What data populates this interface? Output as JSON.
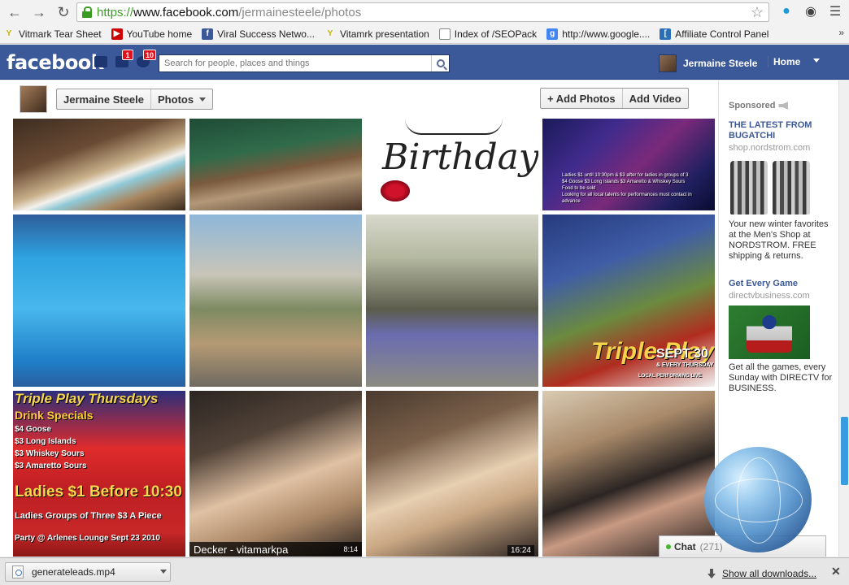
{
  "browser": {
    "url_scheme": "https://",
    "url_host": "www.facebook.com",
    "url_path": "/jermainesteele/photos",
    "bookmarks": [
      {
        "label": "Vitmark Tear Sheet",
        "icon": "vitmark-icon",
        "color": "#c8b400"
      },
      {
        "label": "YouTube home",
        "icon": "youtube-icon",
        "color": "#cc0000"
      },
      {
        "label": "Viral Success Netwo...",
        "icon": "facebook-icon",
        "color": "#3b5998"
      },
      {
        "label": "Vitamrk presentation",
        "icon": "vitmark-icon",
        "color": "#c8b400"
      },
      {
        "label": "Index of /SEOPack",
        "icon": "page-icon",
        "color": "#888888"
      },
      {
        "label": "http://www.google....",
        "icon": "google-icon",
        "color": "#4285f4"
      },
      {
        "label": "Affiliate Control Panel",
        "icon": "bracket-icon",
        "color": "#2d6fb7"
      }
    ],
    "bookmarks_more": "»"
  },
  "fb": {
    "logo": "facebook",
    "friend_requests_badge": "",
    "messages_badge": "1",
    "notifications_badge": "10",
    "search_placeholder": "Search for people, places and things",
    "user_name": "Jermaine Steele",
    "home_label": "Home"
  },
  "album": {
    "owner": "Jermaine Steele",
    "section": "Photos",
    "add_photos": "+ Add Photos",
    "add_video": "Add Video",
    "photos": [
      {
        "id": "cake-1"
      },
      {
        "id": "cake-2"
      },
      {
        "id": "birthday",
        "text": "Birthday"
      },
      {
        "id": "club-flyer-1",
        "lines": [
          "Ladies $1 until 10:30pm & $3 after for ladies in groups of 3",
          "$4 Goose $3 Long Islands $3 Amaretto & Whiskey Sours",
          "Food to be sold",
          "Looking for all local talents for performances must contact in advance"
        ]
      },
      {
        "id": "water-slide"
      },
      {
        "id": "lego-mascot"
      },
      {
        "id": "group-photo"
      },
      {
        "id": "triple-play-flyer",
        "headline": "Triple Play",
        "date": "SEPT 30",
        "sub": "& EVERY THURSDAY",
        "extra": "LOCAL PERFORMING LIVE"
      },
      {
        "id": "triple-play-thursdays",
        "title": "Triple Play Thursdays",
        "lines": [
          "Drink Specials",
          "$4 Goose",
          "$3 Long Islands",
          "$3 Whiskey Sours",
          "$3 Amaretto Sours"
        ],
        "big": "Ladies $1 Before 10:30",
        "sub": "Ladies Groups of Three $3 A Piece",
        "foot": "Party @ Arlenes Lounge Sept 23 2010"
      },
      {
        "id": "video-decker",
        "caption": "Decker - vitamarkpa",
        "time": "8:14"
      },
      {
        "id": "video-blonde",
        "time": "16:24"
      },
      {
        "id": "couple"
      }
    ]
  },
  "sidebar": {
    "sponsored": "Sponsored",
    "ads": [
      {
        "title": "THE LATEST FROM BUGATCHI",
        "url": "shop.nordstrom.com",
        "body": "Your new winter favorites at the Men's Shop at NORDSTROM. FREE shipping & returns."
      },
      {
        "title": "Get Every Game",
        "url": "directvbusiness.com",
        "body": "Get all the games, every Sunday with DIRECTV for BUSINESS."
      }
    ]
  },
  "chat": {
    "label": "Chat",
    "count": "(271)"
  },
  "downloads": {
    "file": "generateleads.mp4",
    "show_all": "Show all downloads..."
  }
}
